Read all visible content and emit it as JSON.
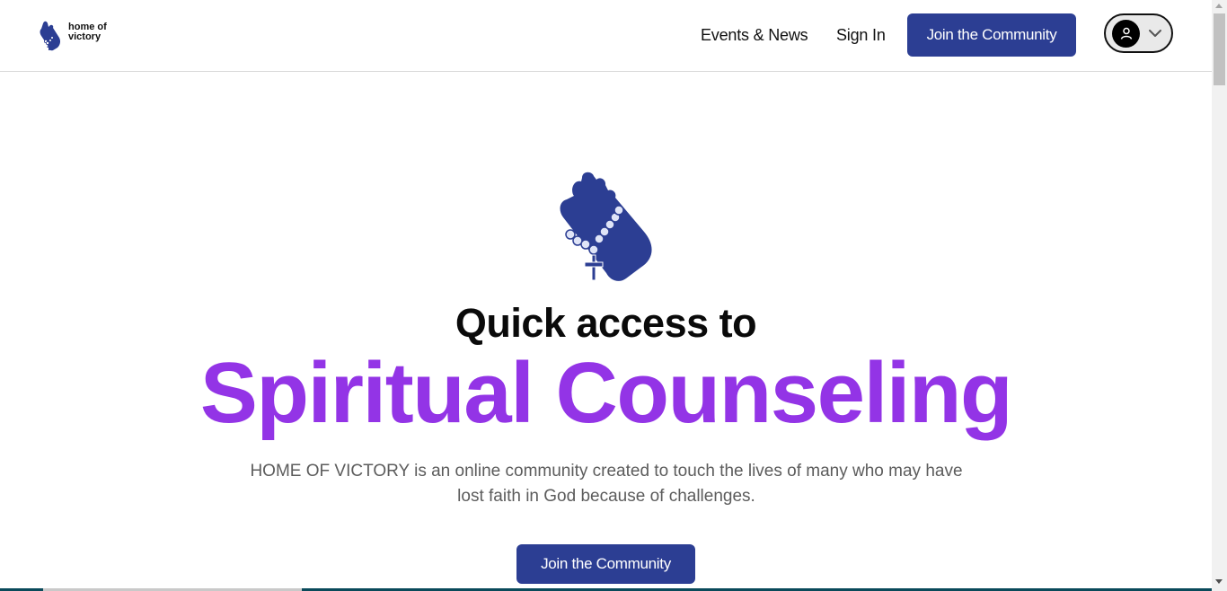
{
  "header": {
    "logo_line1": "home of",
    "logo_line2": "victory",
    "logo_icon": "praying-hands-rosary-logo",
    "nav": {
      "events": "Events & News",
      "signin": "Sign In"
    },
    "cta_label": "Join the Community",
    "user_menu_icon": "user-icon",
    "user_menu_chevron": "chevron-down-icon"
  },
  "hero": {
    "icon": "praying-hands-rosary-icon",
    "line1": "Quick access to",
    "line2": "Spiritual Counseling",
    "description": "HOME OF VICTORY is an online community created to touch the lives of many who may have lost faith in God because of challenges.",
    "cta_label": "Join the Community"
  },
  "colors": {
    "primary": "#2c3e93",
    "accent_purple": "#9334e6",
    "text_dark": "#111111",
    "text_muted": "#5c5c5c"
  }
}
